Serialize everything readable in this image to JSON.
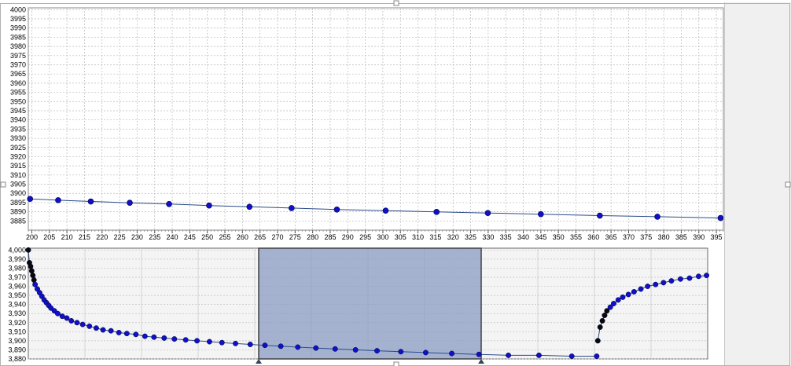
{
  "colors": {
    "marker": "#1010c8",
    "marker_dark": "#0a0a0a",
    "line": "#2a4a8a",
    "grid": "#b8b8b8",
    "selection_fill": "#8a9cc4",
    "selection_border": "#404040"
  },
  "chart_data": [
    {
      "type": "scatter",
      "title": "",
      "xlabel": "",
      "ylabel": "",
      "xlim": [
        199,
        397
      ],
      "ylim": [
        3880,
        4001
      ],
      "grid": true,
      "x_ticks": [
        200,
        205,
        210,
        215,
        220,
        225,
        230,
        235,
        240,
        245,
        250,
        255,
        260,
        265,
        270,
        275,
        280,
        285,
        290,
        295,
        300,
        305,
        310,
        315,
        320,
        325,
        330,
        335,
        340,
        345,
        350,
        355,
        360,
        365,
        370,
        375,
        380,
        385,
        390,
        395
      ],
      "y_ticks": [
        3885,
        3890,
        3895,
        3900,
        3905,
        3910,
        3915,
        3920,
        3925,
        3930,
        3935,
        3940,
        3945,
        3950,
        3955,
        3960,
        3965,
        3970,
        3975,
        3980,
        3985,
        3990,
        3995,
        4000
      ],
      "series": [
        {
          "x": [
            199.5,
            207.5,
            216.8,
            227.9,
            239.1,
            250.5,
            262.0,
            274.0,
            286.9,
            300.8,
            315.3,
            329.9,
            345.0,
            361.8,
            378.2,
            396.2
          ],
          "y": [
            3897.0,
            3896.3,
            3895.6,
            3894.9,
            3894.2,
            3893.4,
            3892.7,
            3892.0,
            3891.2,
            3890.6,
            3889.9,
            3889.3,
            3888.7,
            3887.9,
            3887.3,
            3886.6
          ]
        }
      ]
    },
    {
      "type": "scatter",
      "title": "",
      "xlabel": "",
      "ylabel": "",
      "xlim": [
        0,
        600
      ],
      "ylim": [
        3880,
        4002
      ],
      "grid": true,
      "y_ticks": [
        "4,000",
        "3,990",
        "3,980",
        "3,970",
        "3,960",
        "3,950",
        "3,940",
        "3,930",
        "3,920",
        "3,910",
        "3,900",
        "3,890",
        "3,880"
      ],
      "selection_range": [
        199,
        397
      ],
      "series": [
        {
          "x": [
            0,
            1,
            2,
            3,
            4,
            5,
            6,
            8,
            10,
            12,
            14,
            16,
            18,
            20,
            23,
            26,
            30,
            34,
            38,
            43,
            48,
            54,
            60,
            66,
            73,
            80,
            87,
            95,
            103,
            111,
            120,
            129,
            139,
            149,
            160,
            171,
            183,
            196,
            209,
            223,
            238,
            254,
            271,
            289,
            308,
            329,
            351,
            374,
            398,
            424,
            451,
            480,
            502
          ],
          "y": [
            4000,
            3986,
            3982,
            3977,
            3972,
            3967,
            3962,
            3957,
            3953,
            3949,
            3945,
            3942,
            3939,
            3936,
            3933,
            3930,
            3927,
            3925,
            3922,
            3920,
            3918,
            3916,
            3914,
            3912,
            3911,
            3909,
            3908,
            3907,
            3905,
            3904,
            3903,
            3902,
            3901,
            3900,
            3899,
            3898,
            3897,
            3896,
            3895,
            3894,
            3893,
            3892,
            3891,
            3890,
            3889,
            3888,
            3887,
            3886,
            3885,
            3884,
            3884,
            3883,
            3883
          ]
        },
        {
          "x": [
            503,
            505,
            507,
            509,
            511,
            514,
            517,
            521,
            525,
            530,
            535,
            541,
            547,
            554,
            561,
            568,
            576,
            584,
            592,
            599
          ],
          "y": [
            3900,
            3915,
            3922,
            3928,
            3933,
            3937,
            3941,
            3945,
            3948,
            3951,
            3954,
            3957,
            3960,
            3962,
            3964,
            3966,
            3968,
            3969,
            3971,
            3972
          ]
        }
      ]
    }
  ]
}
